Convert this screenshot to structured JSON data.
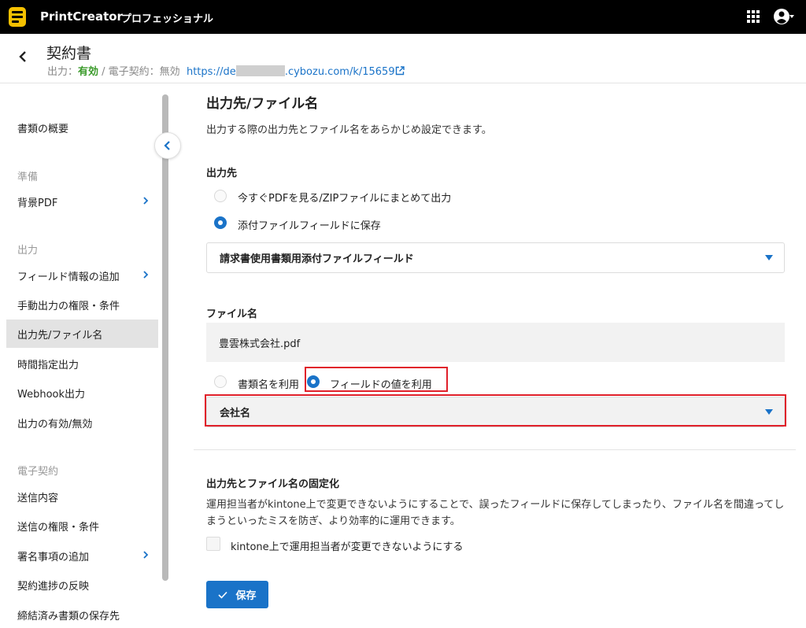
{
  "topbar": {
    "app_name": "PrintCreator",
    "edition": "プロフェッショナル",
    "logo_icon": "printcreator-logo-icon",
    "apps_icon": "grid-apps-icon",
    "account_icon": "account-circle-icon"
  },
  "header": {
    "title": "契約書",
    "status_prefix": "出力：",
    "status_output": "有効",
    "status_sep": " / 電子契約：無効",
    "url_start": "https://de",
    "url_end": ".cybozu.com/k/15659",
    "colors": {
      "active": "#3a9a2a",
      "link": "#1a73c8"
    }
  },
  "sidebar": {
    "items": [
      {
        "label": "書類の概要"
      },
      {
        "label": "背景PDF"
      },
      {
        "label": "フィールド情報の追加"
      },
      {
        "label": "手動出力の権限・条件"
      },
      {
        "label": "出力先/ファイル名"
      },
      {
        "label": "時間指定出力"
      },
      {
        "label": "Webhook出力"
      },
      {
        "label": "出力の有効/無効"
      },
      {
        "label": "送信内容"
      },
      {
        "label": "送信の権限・条件"
      },
      {
        "label": "署名事項の追加"
      },
      {
        "label": "契約進捗の反映"
      },
      {
        "label": "締結済み書類の保存先"
      }
    ],
    "sections": {
      "prep": "準備",
      "output": "出力",
      "econtract": "電子契約"
    },
    "active_index": 4
  },
  "main": {
    "title": "出力先/ファイル名",
    "description": "出力する際の出力先とファイル名をあらかじめ設定できます。",
    "dest_label": "出力先",
    "dest_option_1": "今すぐPDFを見る/ZIPファイルにまとめて出力",
    "dest_option_2": "添付ファイルフィールドに保存",
    "dest_select": "請求書使用書類用添付ファイルフィールド",
    "filename_label": "ファイル名",
    "filename_value": "豊雲株式会社.pdf",
    "fn_option_1": "書類名を利用",
    "fn_option_2": "フィールドの値を利用",
    "fn_select": "会社名",
    "lock_title": "出力先とファイル名の固定化",
    "lock_desc": "運用担当者がkintone上で変更できないようにすることで、誤ったフィールドに保存してしまったり、ファイル名を間違ってしまうといったミスを防ぎ、より効率的に運用できます。",
    "lock_checkbox": "kintone上で運用担当者が変更できないようにする",
    "save_label": "保存",
    "colors": {
      "primary": "#1a73c8",
      "highlight": "#e0202a"
    }
  }
}
